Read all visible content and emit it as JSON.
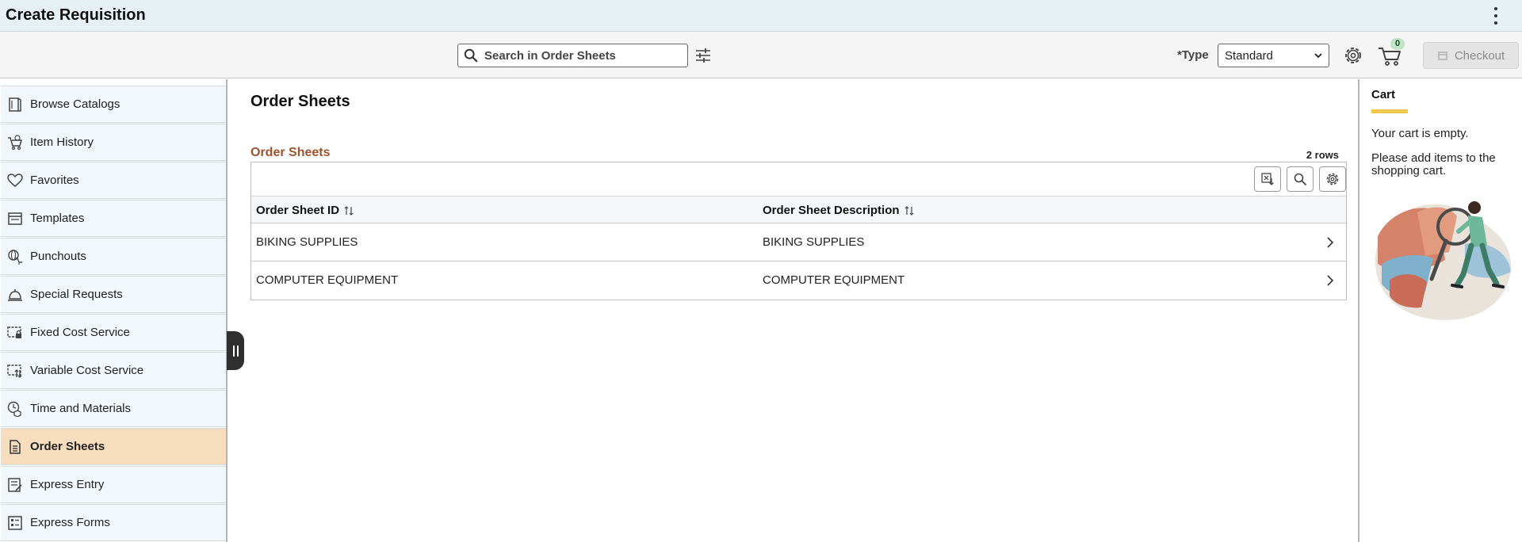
{
  "app": {
    "title": "Create Requisition"
  },
  "toolbar": {
    "search_placeholder": "Search in Order Sheets",
    "type_label": "*Type",
    "type_value": "Standard",
    "cart_count": "0",
    "checkout_label": "Checkout"
  },
  "sidebar": {
    "items": [
      {
        "label": "Browse Catalogs",
        "icon": "book-icon"
      },
      {
        "label": "Item History",
        "icon": "cart-history-icon"
      },
      {
        "label": "Favorites",
        "icon": "heart-icon"
      },
      {
        "label": "Templates",
        "icon": "template-icon"
      },
      {
        "label": "Punchouts",
        "icon": "punchout-icon"
      },
      {
        "label": "Special Requests",
        "icon": "bell-icon"
      },
      {
        "label": "Fixed Cost Service",
        "icon": "fixed-cost-icon"
      },
      {
        "label": "Variable Cost Service",
        "icon": "variable-cost-icon"
      },
      {
        "label": "Time and Materials",
        "icon": "time-materials-icon"
      },
      {
        "label": "Order Sheets",
        "icon": "document-icon"
      },
      {
        "label": "Express Entry",
        "icon": "express-entry-icon"
      },
      {
        "label": "Express Forms",
        "icon": "express-forms-icon"
      }
    ],
    "active_index": 9
  },
  "main": {
    "page_title": "Order Sheets",
    "section_title": "Order Sheets",
    "rows_count": "2 rows",
    "columns": [
      "Order Sheet ID",
      "Order Sheet Description"
    ],
    "rows": [
      {
        "id": "BIKING SUPPLIES",
        "description": "BIKING SUPPLIES"
      },
      {
        "id": "COMPUTER EQUIPMENT",
        "description": "COMPUTER EQUIPMENT"
      }
    ]
  },
  "cart": {
    "title": "Cart",
    "empty_text": "Your cart is empty.",
    "help_text": "Please add items to the shopping cart."
  },
  "colors": {
    "accent_orange": "#a0522d",
    "active_item": "#f6ddbd",
    "cart_underline": "#f2c94c"
  }
}
